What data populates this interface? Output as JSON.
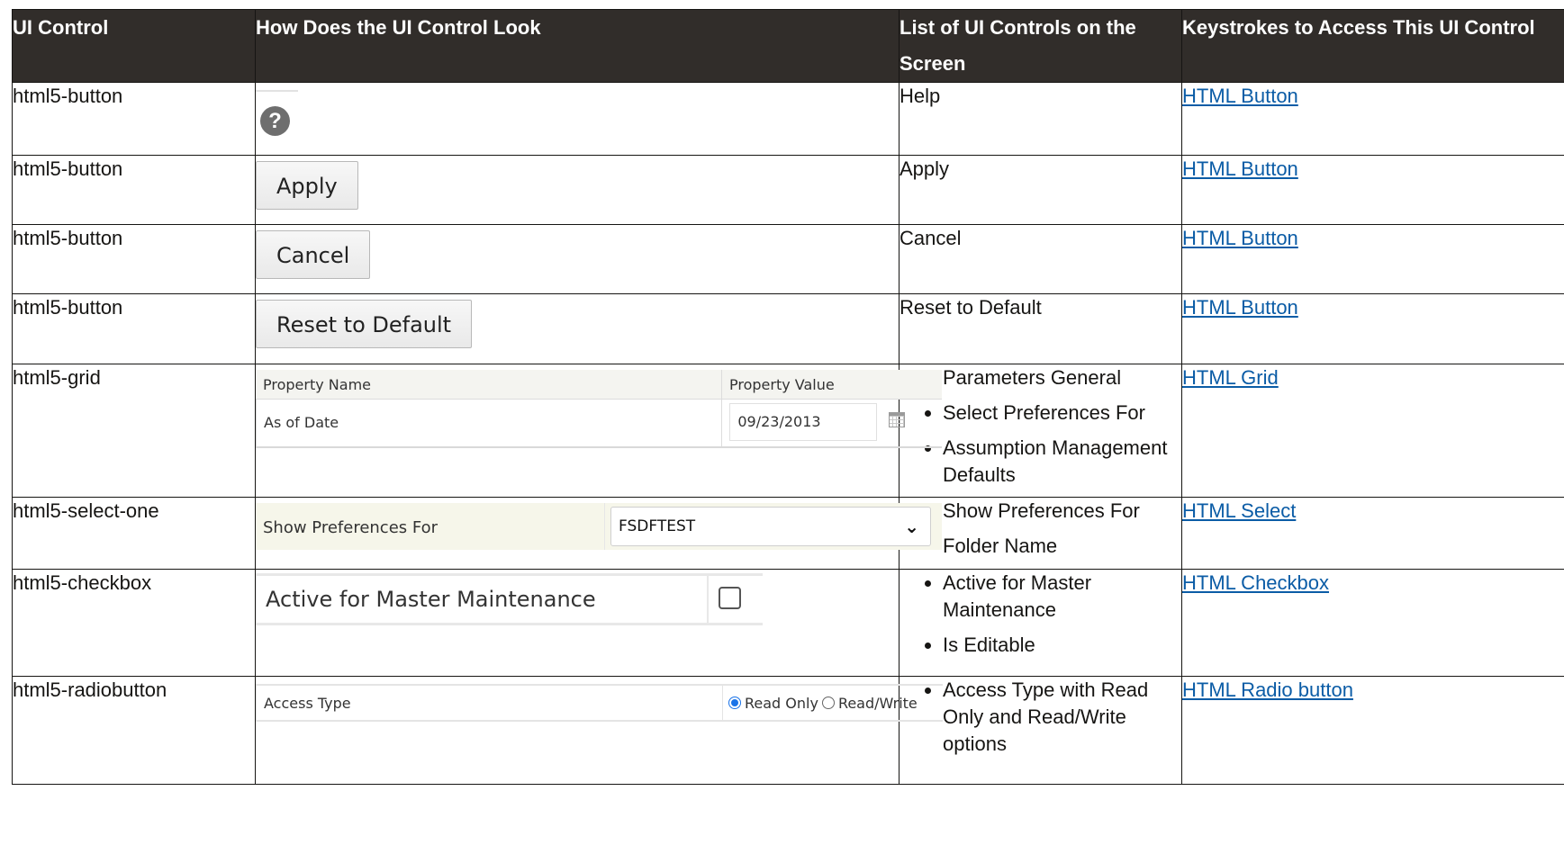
{
  "header": {
    "col1": "UI Control",
    "col2": "How Does the UI Control Look",
    "col3": "List of UI Controls on the Screen",
    "col4": "Keystrokes to Access This UI Control"
  },
  "rows": [
    {
      "control": "html5-button",
      "list": "Help",
      "link": "HTML Button",
      "icon": "help-icon",
      "icon_glyph": "?"
    },
    {
      "control": "html5-button",
      "button_label": "Apply",
      "list": "Apply",
      "link": "HTML Button"
    },
    {
      "control": "html5-button",
      "button_label": "Cancel",
      "list": "Cancel",
      "link": "HTML Button"
    },
    {
      "control": "html5-button",
      "button_label": "Reset to Default",
      "list": "Reset to Default",
      "link": "HTML Button"
    },
    {
      "control": "html5-grid",
      "grid": {
        "col_name": "Property Name",
        "col_value": "Property Value",
        "row_name": "As of Date",
        "row_value": "09/23/2013",
        "icon": "calendar-icon"
      },
      "list_items": [
        "Parameters General",
        "Select Preferences For",
        "Assumption Management Defaults"
      ],
      "link": "HTML Grid"
    },
    {
      "control": "html5-select-one",
      "select": {
        "label": "Show Preferences For",
        "value": "FSDFTEST",
        "icon": "chevron-down-icon"
      },
      "list_items": [
        "Show Preferences For",
        "Folder Name"
      ],
      "link": "HTML Select"
    },
    {
      "control": "html5-checkbox",
      "checkbox": {
        "label": "Active for Master Maintenance",
        "checked": false
      },
      "list_items": [
        "Active for Master Maintenance",
        "Is Editable"
      ],
      "link": "HTML Checkbox"
    },
    {
      "control": "html5-radiobutton",
      "radio": {
        "label": "Access Type",
        "option1": "Read Only",
        "option2": "Read/Write",
        "selected": "Read Only"
      },
      "list_items": [
        "Access Type with Read Only and Read/Write options"
      ],
      "link": "HTML Radio button"
    }
  ],
  "colors": {
    "header_bg": "#312d2a",
    "link": "#0b5ca6",
    "radio_selected": "#1a73e8"
  }
}
